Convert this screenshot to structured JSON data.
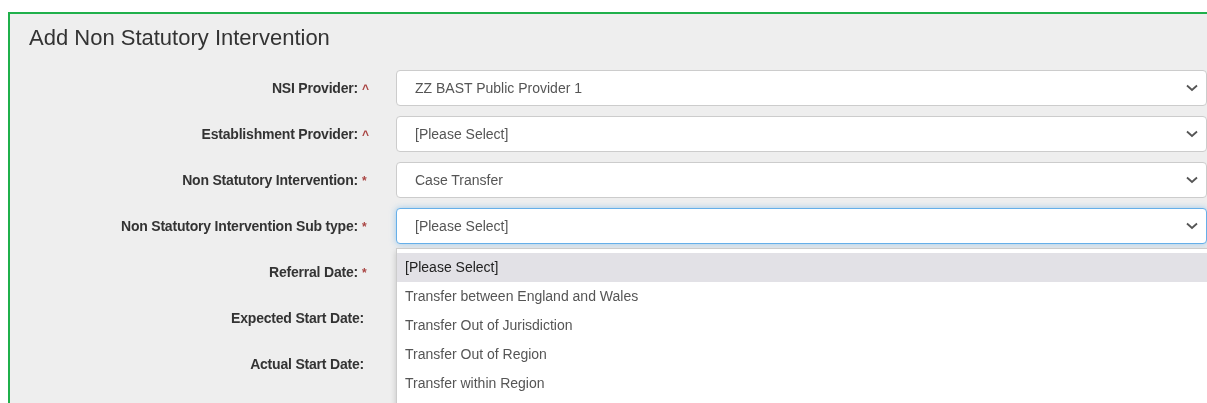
{
  "title": "Add Non Statutory Intervention",
  "fields": [
    {
      "label": "NSI Provider:",
      "marker": "^",
      "kind": "select",
      "value": "ZZ BAST Public Provider 1",
      "focused": false
    },
    {
      "label": "Establishment Provider:",
      "marker": "^",
      "kind": "select",
      "value": "[Please Select]",
      "focused": false
    },
    {
      "label": "Non Statutory Intervention:",
      "marker": "*",
      "kind": "select",
      "value": "Case Transfer",
      "focused": false
    },
    {
      "label": "Non Statutory Intervention Sub type:",
      "marker": "*",
      "kind": "select",
      "value": "[Please Select]",
      "focused": true,
      "options": [
        {
          "label": "[Please Select]",
          "selected": true
        },
        {
          "label": "Transfer between England and Wales",
          "selected": false
        },
        {
          "label": "Transfer Out of Jurisdiction",
          "selected": false
        },
        {
          "label": "Transfer Out of Region",
          "selected": false
        },
        {
          "label": "Transfer within Region",
          "selected": false
        }
      ]
    },
    {
      "label": "Referral Date:",
      "marker": "*",
      "kind": "date"
    },
    {
      "label": "Expected Start Date:",
      "kind": "date"
    },
    {
      "label": "Actual Start Date:",
      "kind": "date"
    }
  ]
}
